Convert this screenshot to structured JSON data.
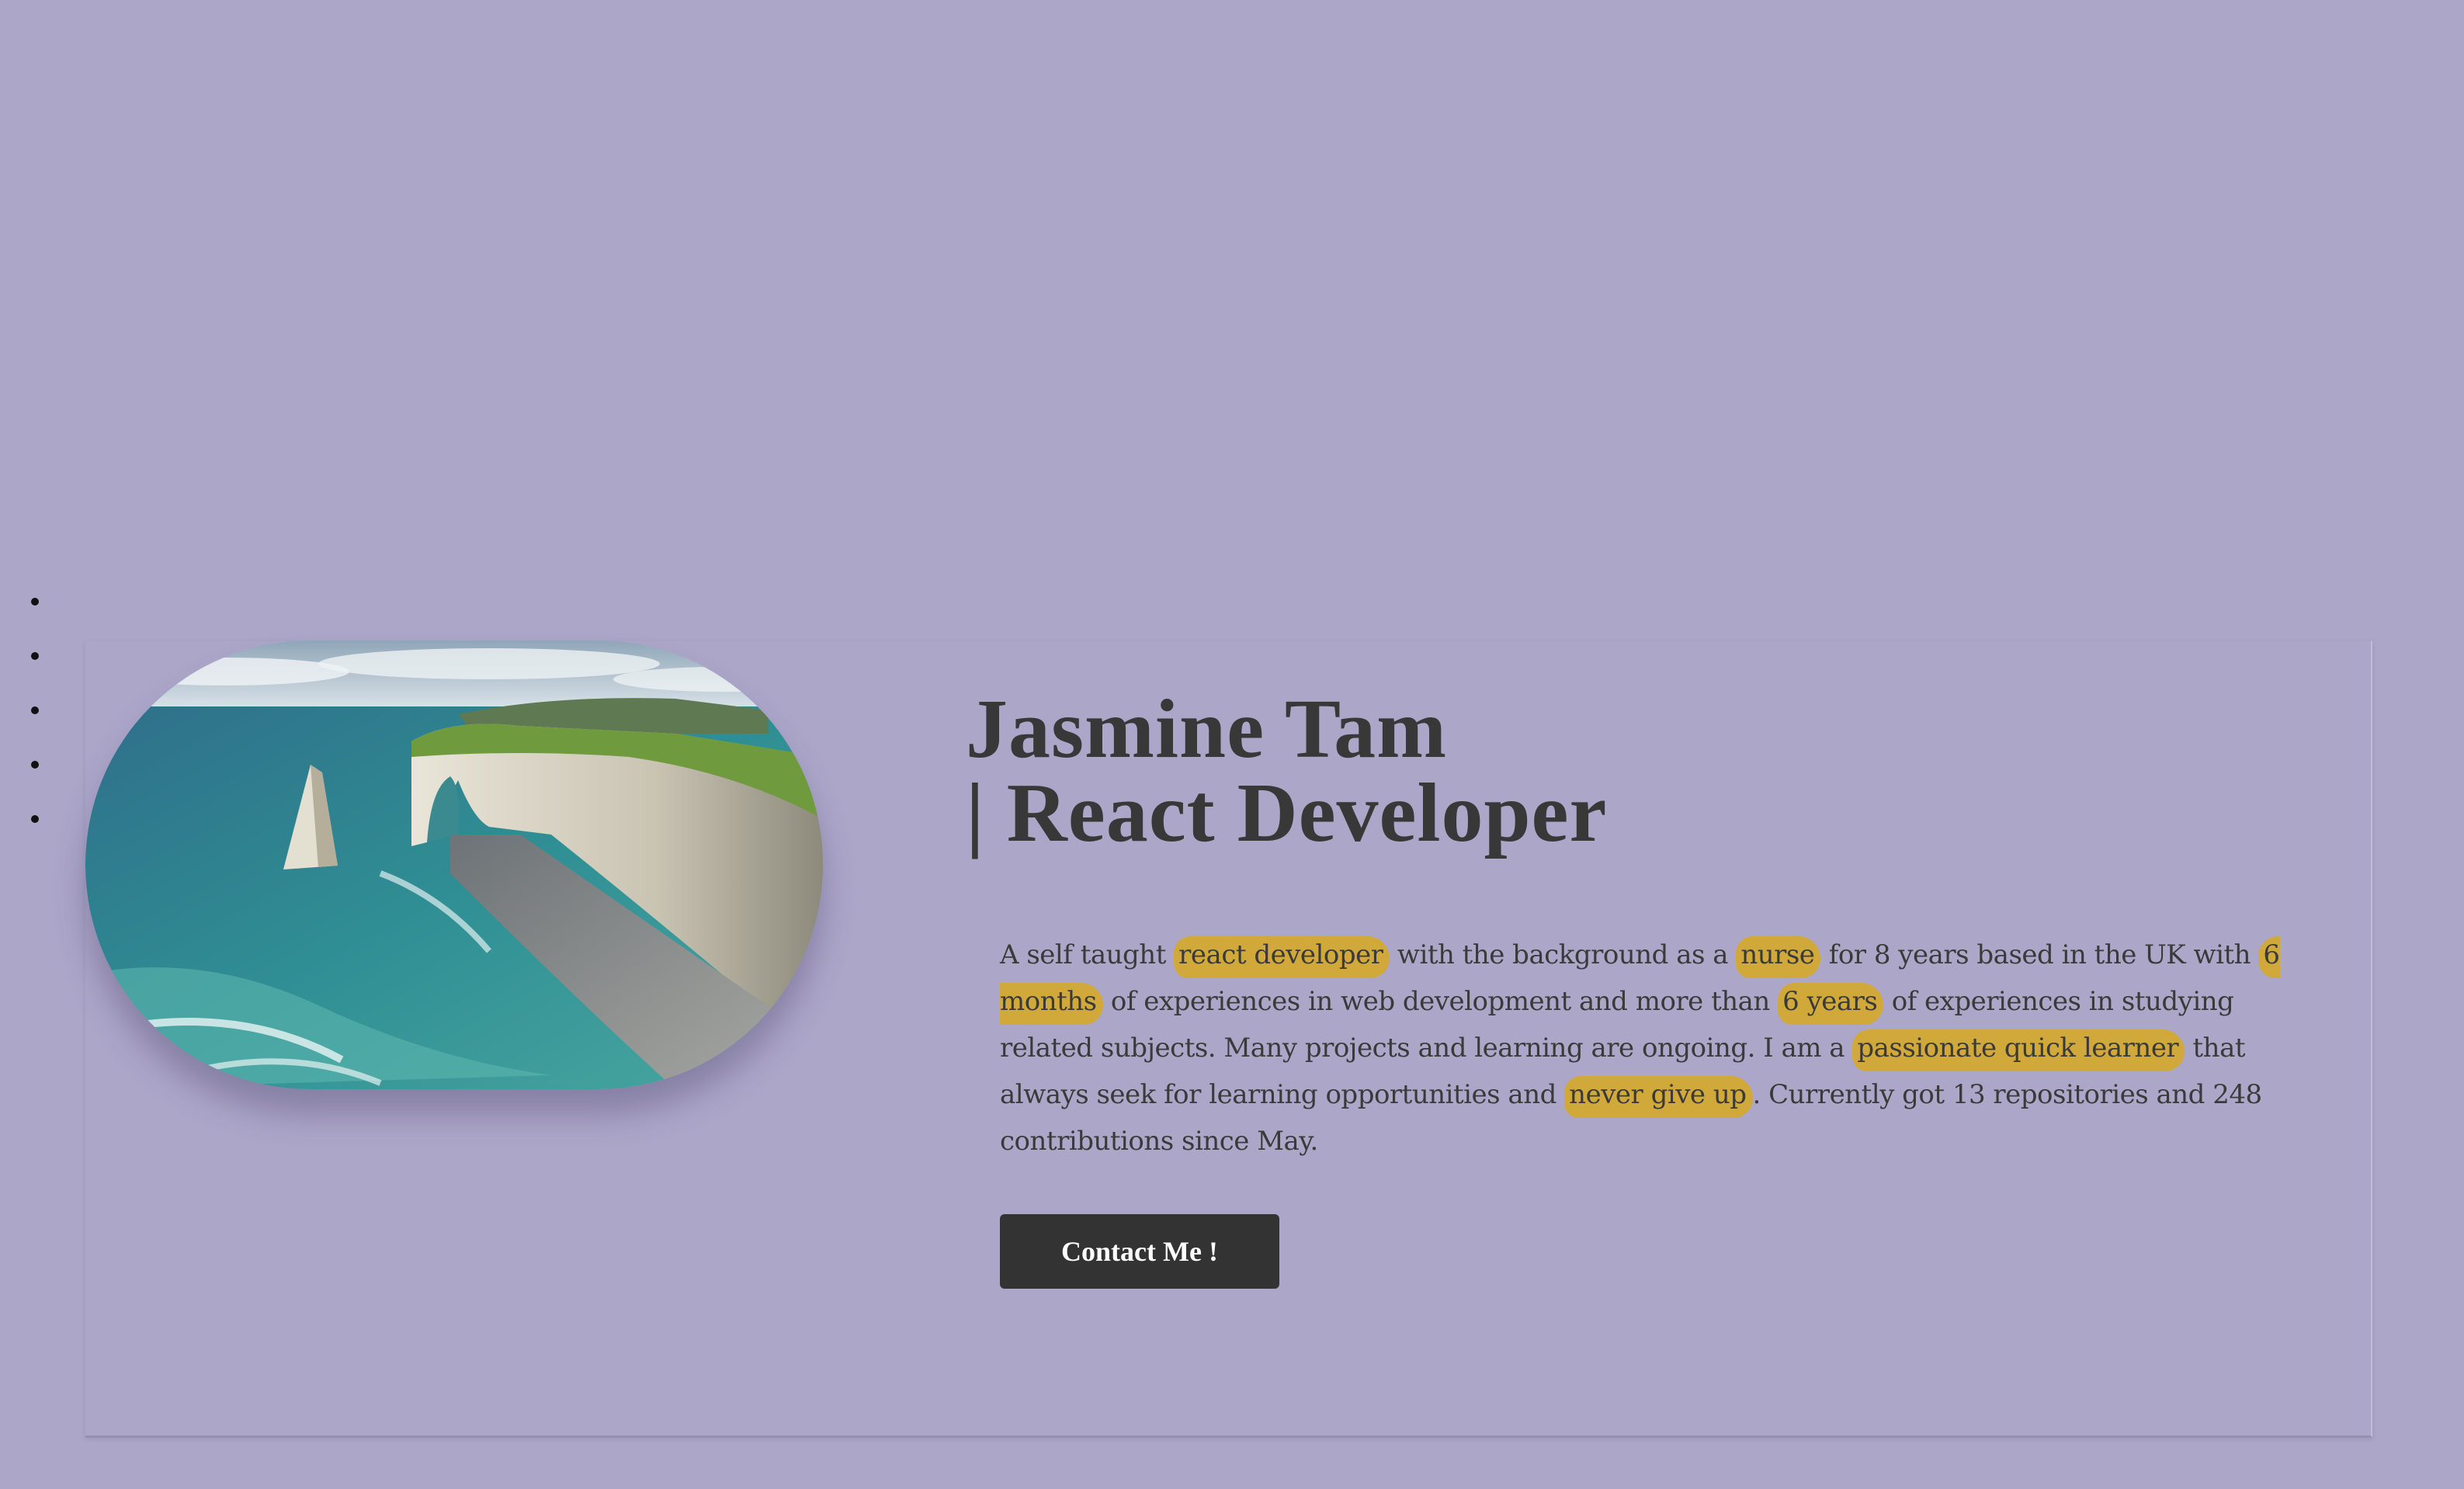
{
  "nav": {
    "items": [
      "",
      "",
      "",
      "",
      ""
    ]
  },
  "hero": {
    "image_alt": "Coastal cliffs with sea arch and rock needle",
    "name_line1": "Jasmine Tam",
    "name_line2": "| React Developer",
    "bio": [
      {
        "text": "A self taught ",
        "hl": false
      },
      {
        "text": "react developer",
        "hl": true
      },
      {
        "text": " with the background as a ",
        "hl": false
      },
      {
        "text": "nurse",
        "hl": true
      },
      {
        "text": " for 8 years based in the UK with ",
        "hl": false
      },
      {
        "text": "6 months",
        "hl": true
      },
      {
        "text": " of experiences in web development and more than ",
        "hl": false
      },
      {
        "text": "6 years",
        "hl": true
      },
      {
        "text": " of experiences in studying related subjects. Many projects and learning are ongoing. I am a ",
        "hl": false
      },
      {
        "text": "passionate quick learner",
        "hl": true
      },
      {
        "text": " that always seek for learning opportunities and ",
        "hl": false
      },
      {
        "text": "never give up",
        "hl": true
      },
      {
        "text": ". Currently got 13 repositories and 248 contributions since May.",
        "hl": false
      }
    ],
    "contact_label": "Contact Me !"
  },
  "colors": {
    "background": "#aca6c9",
    "text": "#383838",
    "highlight": "#d1a93a",
    "button": "#333333",
    "button_text": "#ffffff"
  }
}
